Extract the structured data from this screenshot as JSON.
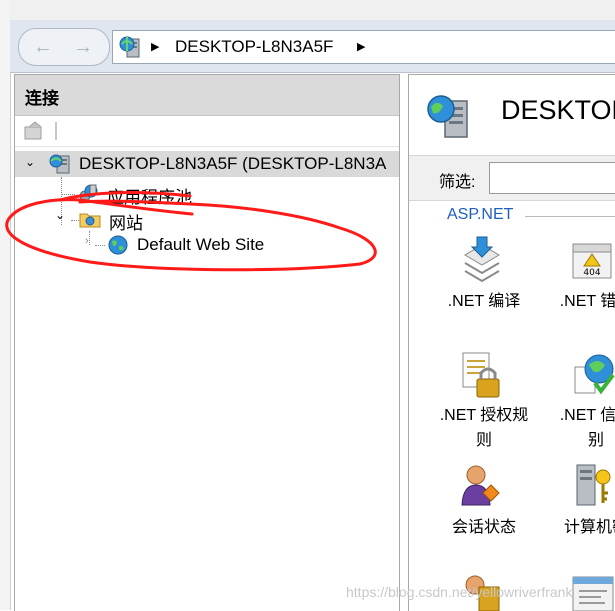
{
  "nav": {
    "address_text": "DESKTOP-L8N3A5F"
  },
  "left_pane": {
    "header": "连接",
    "tree": {
      "server": "DESKTOP-L8N3A5F (DESKTOP-L8N3A",
      "app_pools": "应用程序池",
      "sites": "网站",
      "default_site": "Default Web Site"
    }
  },
  "right_pane": {
    "title": "DESKTOP",
    "filter_label": "筛选:",
    "group_label": "ASP.NET",
    "features": [
      {
        "label": ".NET 编译"
      },
      {
        "label": ".NET 错误"
      },
      {
        "label": ".NET 授权规\n则"
      },
      {
        "label": ".NET 信任\n别"
      },
      {
        "label": "会话状态"
      },
      {
        "label": "计算机密"
      }
    ]
  },
  "watermark": "https://blog.csdn.net/yellowriverfrank",
  "colors": {
    "nav_bg": "#dfe6ef",
    "pane_header_bg": "#dadada",
    "group_label": "#1f5fbf",
    "annotation_red": "#ff1a1a"
  }
}
